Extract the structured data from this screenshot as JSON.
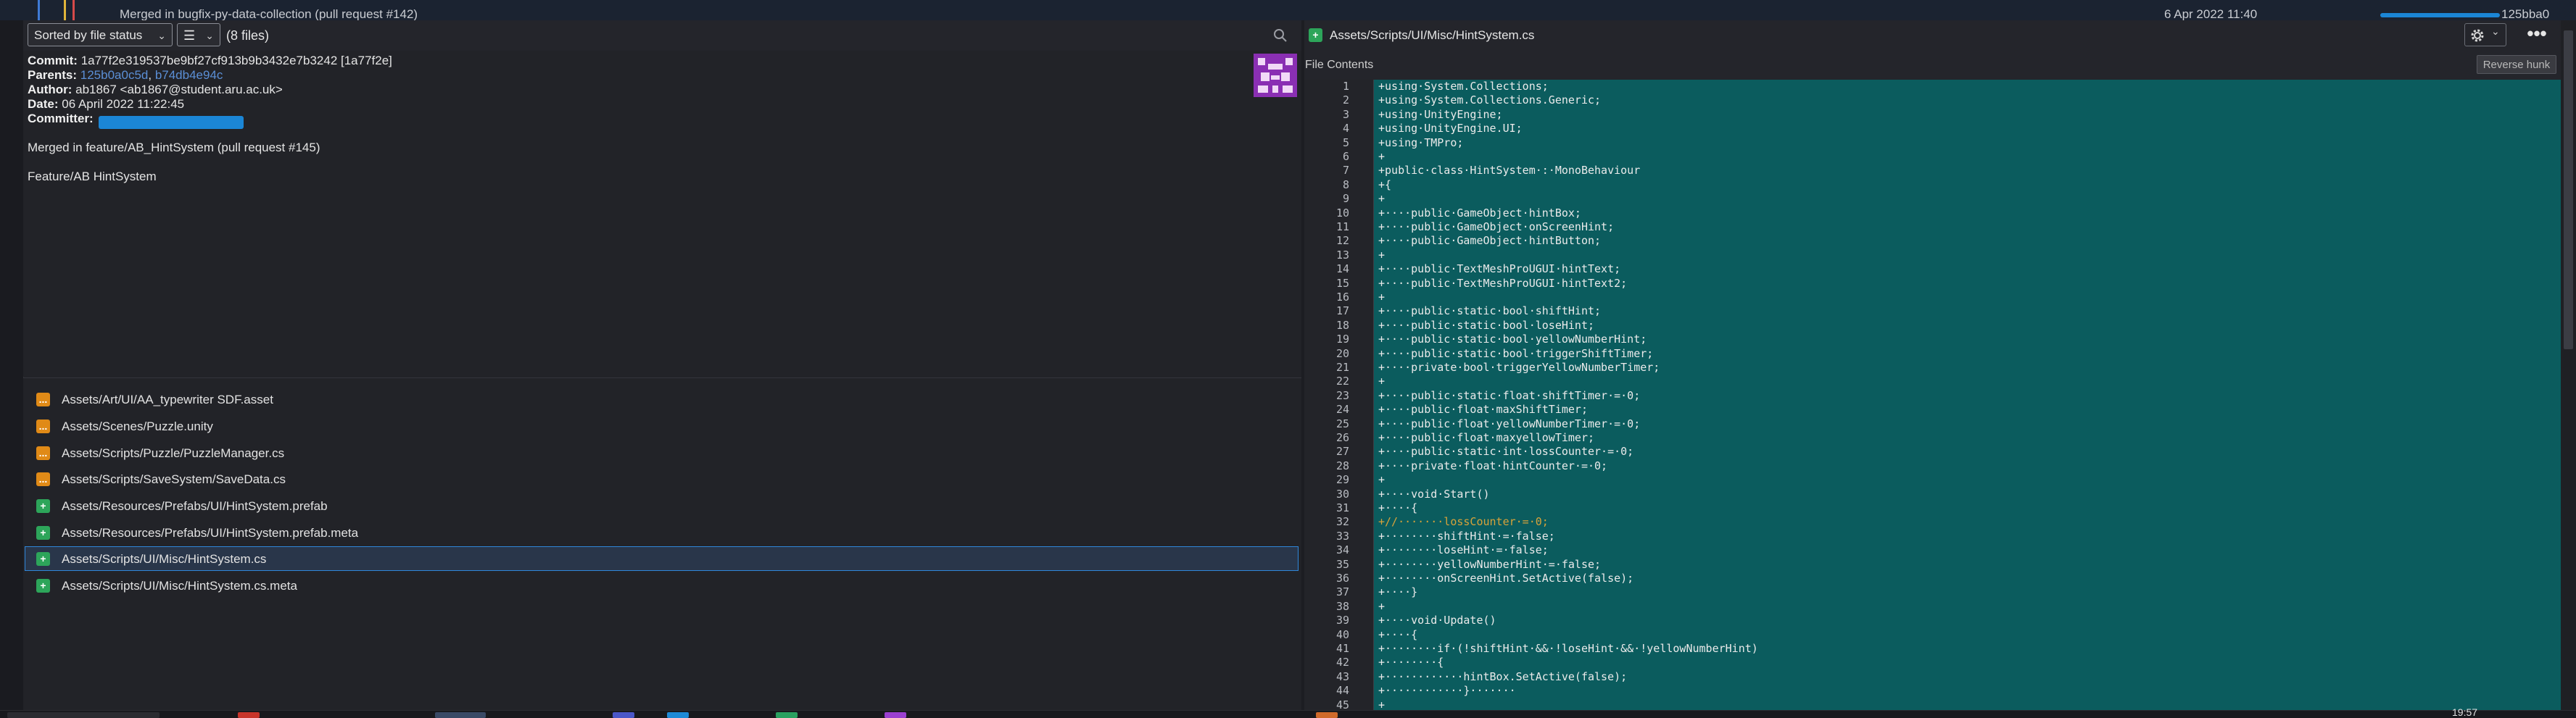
{
  "top_strip": {
    "history_message": "Merged in bugfix-py-data-collection (pull request #142)",
    "history_date": "6 Apr 2022 11:40",
    "history_hash": "125bba0"
  },
  "left_toolbar": {
    "sort_label": "Sorted by file status",
    "view_icon": "list-icon",
    "files_count": "(8 files)"
  },
  "commit": {
    "commit_label": "Commit:",
    "commit_value": "1a77f2e319537be9bf27cf913b9b3432e7b3242 [1a77f2e]",
    "parents_label": "Parents:",
    "parent1": "125b0a0c5d",
    "parent_sep": ", ",
    "parent2": "b74db4e94c",
    "author_label": "Author:",
    "author_value": "ab1867 <ab1867@student.aru.ac.uk>",
    "date_label": "Date:",
    "date_value": "06 April 2022 11:22:45",
    "committer_label": "Committer:",
    "message_line1": "Merged in feature/AB_HintSystem (pull request #145)",
    "message_line2": "Feature/AB HintSystem"
  },
  "files": [
    {
      "path": "Assets/Art/UI/AA_typewriter SDF.asset",
      "status": "modified",
      "icon": "..."
    },
    {
      "path": "Assets/Scenes/Puzzle.unity",
      "status": "modified",
      "icon": "..."
    },
    {
      "path": "Assets/Scripts/Puzzle/PuzzleManager.cs",
      "status": "modified",
      "icon": "..."
    },
    {
      "path": "Assets/Scripts/SaveSystem/SaveData.cs",
      "status": "modified",
      "icon": "..."
    },
    {
      "path": "Assets/Resources/Prefabs/UI/HintSystem.prefab",
      "status": "added",
      "icon": "+"
    },
    {
      "path": "Assets/Resources/Prefabs/UI/HintSystem.prefab.meta",
      "status": "added",
      "icon": "+"
    },
    {
      "path": "Assets/Scripts/UI/Misc/HintSystem.cs",
      "status": "added",
      "icon": "+"
    },
    {
      "path": "Assets/Scripts/UI/Misc/HintSystem.cs.meta",
      "status": "added",
      "icon": "+"
    }
  ],
  "selected_file_index": 6,
  "right_header": {
    "status_icon": "+",
    "file_path": "Assets/Scripts/UI/Misc/HintSystem.cs",
    "more_label": "•••"
  },
  "file_contents_bar": {
    "label": "File Contents",
    "reverse_hunk_label": "Reverse hunk"
  },
  "code_lines": [
    {
      "n": "1",
      "t": "+using·System.Collections;"
    },
    {
      "n": "2",
      "t": "+using·System.Collections.Generic;"
    },
    {
      "n": "3",
      "t": "+using·UnityEngine;"
    },
    {
      "n": "4",
      "t": "+using·UnityEngine.UI;"
    },
    {
      "n": "5",
      "t": "+using·TMPro;"
    },
    {
      "n": "6",
      "t": "+"
    },
    {
      "n": "7",
      "t": "+public·class·HintSystem·:·MonoBehaviour"
    },
    {
      "n": "8",
      "t": "+{"
    },
    {
      "n": "9",
      "t": "+"
    },
    {
      "n": "10",
      "t": "+····public·GameObject·hintBox;"
    },
    {
      "n": "11",
      "t": "+····public·GameObject·onScreenHint;"
    },
    {
      "n": "12",
      "t": "+····public·GameObject·hintButton;"
    },
    {
      "n": "13",
      "t": "+"
    },
    {
      "n": "14",
      "t": "+····public·TextMeshProUGUI·hintText;"
    },
    {
      "n": "15",
      "t": "+····public·TextMeshProUGUI·hintText2;"
    },
    {
      "n": "16",
      "t": "+"
    },
    {
      "n": "17",
      "t": "+····public·static·bool·shiftHint;"
    },
    {
      "n": "18",
      "t": "+····public·static·bool·loseHint;"
    },
    {
      "n": "19",
      "t": "+····public·static·bool·yellowNumberHint;"
    },
    {
      "n": "20",
      "t": "+····public·static·bool·triggerShiftTimer;"
    },
    {
      "n": "21",
      "t": "+····private·bool·triggerYellowNumberTimer;"
    },
    {
      "n": "22",
      "t": "+"
    },
    {
      "n": "23",
      "t": "+····public·static·float·shiftTimer·=·0;"
    },
    {
      "n": "24",
      "t": "+····public·float·maxShiftTimer;"
    },
    {
      "n": "25",
      "t": "+····public·float·yellowNumberTimer·=·0;"
    },
    {
      "n": "26",
      "t": "+····public·float·maxyellowTimer;"
    },
    {
      "n": "27",
      "t": "+····public·static·int·lossCounter·=·0;"
    },
    {
      "n": "28",
      "t": "+····private·float·hintCounter·=·0;"
    },
    {
      "n": "29",
      "t": "+"
    },
    {
      "n": "30",
      "t": "+····void·Start()"
    },
    {
      "n": "31",
      "t": "+····{"
    },
    {
      "n": "32",
      "t": "+//·······lossCounter·=·0;"
    },
    {
      "n": "33",
      "t": "+········shiftHint·=·false;"
    },
    {
      "n": "34",
      "t": "+········loseHint·=·false;"
    },
    {
      "n": "35",
      "t": "+········yellowNumberHint·=·false;"
    },
    {
      "n": "36",
      "t": "+········onScreenHint.SetActive(false);"
    },
    {
      "n": "37",
      "t": "+····}"
    },
    {
      "n": "38",
      "t": "+"
    },
    {
      "n": "39",
      "t": "+····void·Update()"
    },
    {
      "n": "40",
      "t": "+····{"
    },
    {
      "n": "41",
      "t": "+········if·(!shiftHint·&&·!loseHint·&&·!yellowNumberHint)"
    },
    {
      "n": "42",
      "t": "+········{"
    },
    {
      "n": "43",
      "t": "+············hintBox.SetActive(false);"
    },
    {
      "n": "44",
      "t": "+············}·······"
    },
    {
      "n": "45",
      "t": "+"
    }
  ],
  "taskbar": {
    "clock": "19:57"
  },
  "colors": {
    "added": "#2da55a",
    "modified": "#e08a17",
    "code_bg": "#0b5c5e",
    "selection_border": "#2f86d9",
    "link": "#5b8fd6"
  }
}
